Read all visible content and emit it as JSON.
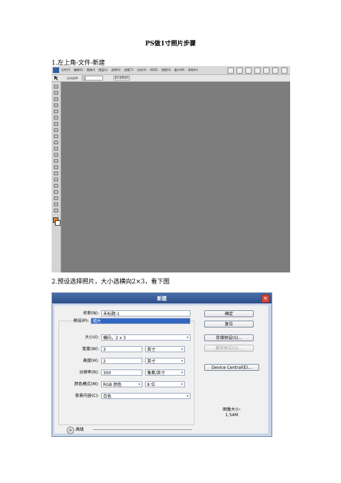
{
  "doc": {
    "title": "PS做1寸照片步骤",
    "step1": "1.左上角-文件-新建",
    "step2": "2.预设选择照片，大小选横向2×3，看下图"
  },
  "photoshop": {
    "menus": [
      "文件(F)",
      "编辑(E)",
      "图像(I)",
      "图层(L)",
      "选择(S)",
      "滤镜(T)",
      "分析(A)",
      "3D(D)",
      "视图(V)",
      "窗口(W)",
      "帮助(H)"
    ],
    "options_label": "自动选择:",
    "options_value": "组",
    "options_button": "显示变换控件",
    "icons": [
      "move-tool-icon",
      "marquee-tool-icon",
      "lasso-tool-icon",
      "quick-select-tool-icon",
      "crop-tool-icon",
      "eyedropper-tool-icon",
      "healing-brush-tool-icon",
      "brush-tool-icon",
      "clone-stamp-tool-icon",
      "history-brush-tool-icon",
      "eraser-tool-icon",
      "gradient-tool-icon",
      "blur-tool-icon",
      "dodge-tool-icon",
      "pen-tool-icon",
      "type-tool-icon",
      "path-select-tool-icon",
      "shape-tool-icon",
      "3d-rotate-tool-icon",
      "hand-tool-icon",
      "zoom-tool-icon"
    ],
    "colors": {
      "foreground": "#e8862a",
      "background": "#ffffff",
      "canvas": "#7d7d7d"
    }
  },
  "dialog": {
    "title": "新建",
    "close": "✕",
    "name_label": "名称(N):",
    "name_value": "未标题-1",
    "preset_label": "预设(P):",
    "preset_value": "照片",
    "size_label": "大小(I):",
    "size_value": "横向，2 x 3",
    "width_label": "宽度(W):",
    "width_value": "3",
    "width_unit": "英寸",
    "height_label": "高度(H):",
    "height_value": "2",
    "height_unit": "英寸",
    "resolution_label": "分辨率(R):",
    "resolution_value": "300",
    "resolution_unit": "像素/英寸",
    "color_mode_label": "颜色模式(M):",
    "color_mode_value": "RGB 颜色",
    "bit_depth_value": "8 位",
    "background_label": "背景内容(C):",
    "background_value": "白色",
    "advanced_label": "高级",
    "buttons": {
      "ok": "确定",
      "reset": "复位",
      "save_preset": "存储预设(S)...",
      "delete_preset": "删除预设(D)...",
      "device_central": "Device Central(E)..."
    },
    "image_size_label": "图像大小:",
    "image_size_value": "1.54M"
  }
}
